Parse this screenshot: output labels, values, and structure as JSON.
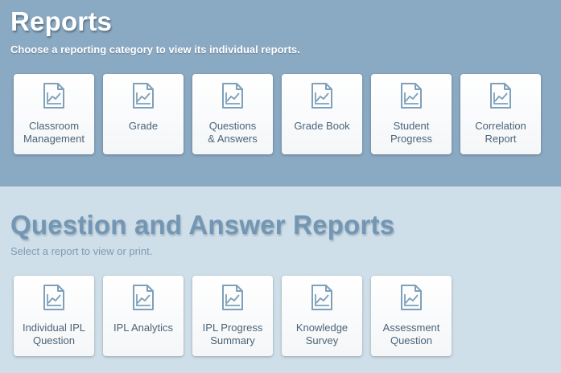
{
  "reports": {
    "title": "Reports",
    "subtitle": "Choose a reporting category to view its individual reports.",
    "cards": [
      {
        "line1": "Classroom",
        "line2": "Management"
      },
      {
        "line1": "Grade",
        "line2": ""
      },
      {
        "line1": "Questions",
        "line2": "& Answers"
      },
      {
        "line1": "Grade Book",
        "line2": ""
      },
      {
        "line1": "Student",
        "line2": "Progress"
      },
      {
        "line1": "Correlation",
        "line2": "Report"
      }
    ]
  },
  "qa_reports": {
    "title": "Question and Answer Reports",
    "subtitle": "Select a report to view or print.",
    "cards": [
      {
        "line1": "Individual IPL",
        "line2": "Question"
      },
      {
        "line1": "IPL Analytics",
        "line2": ""
      },
      {
        "line1": "IPL Progress",
        "line2": "Summary"
      },
      {
        "line1": "Knowledge",
        "line2": "Survey"
      },
      {
        "line1": "Assessment",
        "line2": "Question"
      }
    ]
  },
  "card_icon": "report-chart-icon",
  "colors": {
    "header_bg": "#8aa9c2",
    "body_bg": "#cedfe9",
    "icon": "#7fa0ba",
    "card_text": "#4c6478"
  }
}
